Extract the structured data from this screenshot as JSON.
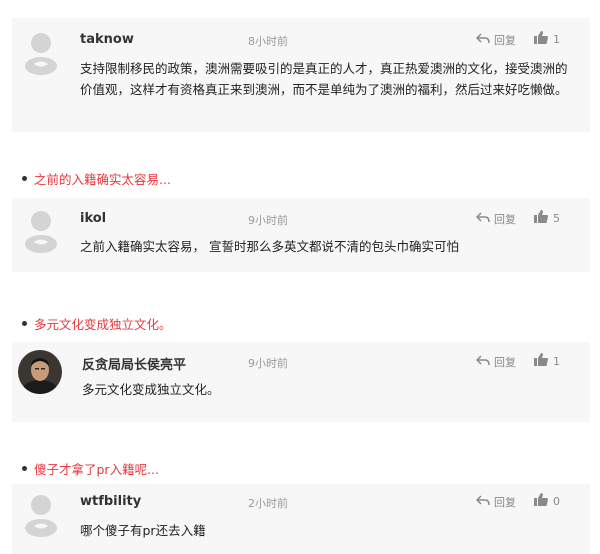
{
  "comments": [
    {
      "user": "taknow",
      "time": "8小时前",
      "reply": "回复",
      "likes": "1",
      "text": "支持限制移民的政策，澳洲需要吸引的是真正的人才，真正热爱澳洲的文化，接受澳洲的价值观，这样才有资格真正来到澳洲，而不是单纯为了澳洲的福利，然后过来好吃懒做。"
    },
    {
      "quote": "之前的入籍确实太容易...",
      "user": "ikol",
      "time": "9小时前",
      "reply": "回复",
      "likes": "5",
      "text": "之前入籍确实太容易， 宣誓时那么多英文都说不清的包头巾确实可怕"
    },
    {
      "quote": "多元文化变成独立文化。",
      "user": "反贪局局长侯亮平",
      "time": "9小时前",
      "reply": "回复",
      "likes": "1",
      "text": "多元文化变成独立文化。"
    },
    {
      "quote": "傻子才拿了pr入籍呢...",
      "user": "wtfbility",
      "time": "2小时前",
      "reply": "回复",
      "likes": "0",
      "text": "哪个傻子有pr还去入籍"
    }
  ],
  "icons": {
    "reply": "reply-arrow-icon",
    "like": "thumbs-up-icon",
    "default_avatar": "default-avatar-icon"
  },
  "colors": {
    "quote": "#e8383d",
    "card_bg": "#f7f7f7"
  }
}
